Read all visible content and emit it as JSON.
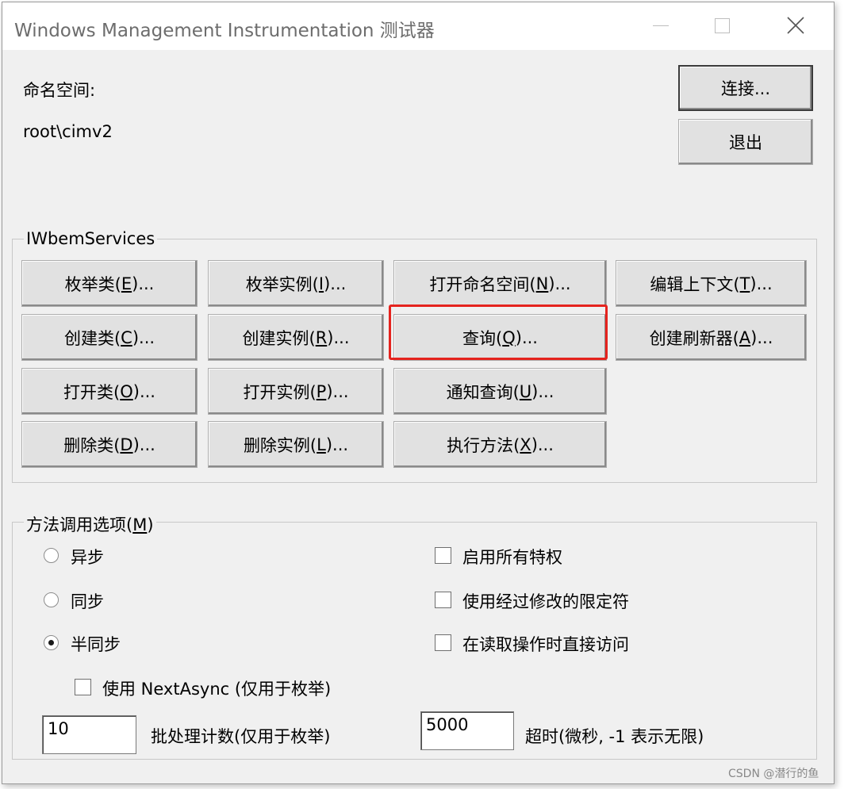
{
  "window": {
    "title": "Windows Management Instrumentation 测试器"
  },
  "namespace": {
    "label": "命名空间:",
    "value": "root\\cimv2"
  },
  "side_buttons": {
    "connect": "连接...",
    "exit": "退出"
  },
  "iwbem": {
    "title": "IWbemServices",
    "buttons": [
      {
        "pre": "枚举类(",
        "key": "E",
        "post": ")..."
      },
      {
        "pre": "枚举实例(",
        "key": "I",
        "post": ")..."
      },
      {
        "pre": "打开命名空间(",
        "key": "N",
        "post": ")..."
      },
      {
        "pre": "编辑上下文(",
        "key": "T",
        "post": ")..."
      },
      {
        "pre": "创建类(",
        "key": "C",
        "post": ")..."
      },
      {
        "pre": "创建实例(",
        "key": "R",
        "post": ")..."
      },
      {
        "pre": "查询(",
        "key": "Q",
        "post": ")..."
      },
      {
        "pre": "创建刷新器(",
        "key": "A",
        "post": ")..."
      },
      {
        "pre": "打开类(",
        "key": "O",
        "post": ")..."
      },
      {
        "pre": "打开实例(",
        "key": "P",
        "post": ")..."
      },
      {
        "pre": "通知查询(",
        "key": "U",
        "post": ")..."
      },
      {
        "pre": "删除类(",
        "key": "D",
        "post": ")..."
      },
      {
        "pre": "删除实例(",
        "key": "L",
        "post": ")..."
      },
      {
        "pre": "执行方法(",
        "key": "X",
        "post": ")..."
      }
    ]
  },
  "method_options": {
    "title_pre": "方法调用选项(",
    "title_key": "M",
    "title_post": ")",
    "radios": [
      {
        "label": "异步",
        "checked": false
      },
      {
        "label": "同步",
        "checked": false
      },
      {
        "label": "半同步",
        "checked": true
      }
    ],
    "checkboxes": [
      {
        "label": "启用所有特权",
        "checked": false
      },
      {
        "label": "使用经过修改的限定符",
        "checked": false
      },
      {
        "label": "在读取操作时直接访问",
        "checked": false
      }
    ],
    "next_async": {
      "label": "使用 NextAsync (仅用于枚举)",
      "checked": false
    },
    "batch_count": {
      "value": "10",
      "label": "批处理计数(仅用于枚举)"
    },
    "timeout": {
      "value": "5000",
      "label": "超时(微秒, -1 表示无限)"
    }
  },
  "highlight_color": "#e5231e",
  "watermark": "CSDN @潜行的鱼"
}
